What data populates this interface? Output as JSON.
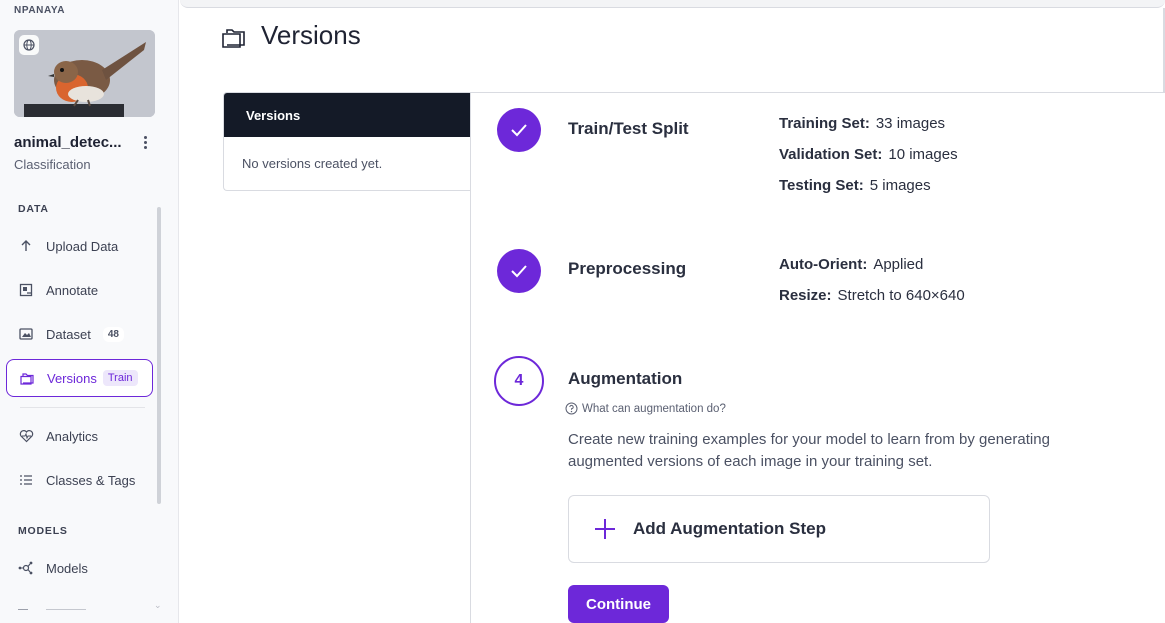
{
  "sidebar": {
    "workspace_name": "NPANAYA",
    "project_name": "animal_detec...",
    "project_type": "Classification",
    "sections": {
      "data": "DATA",
      "models": "MODELS"
    },
    "items": [
      {
        "label": "Upload Data",
        "icon": "upload-arrow-icon"
      },
      {
        "label": "Annotate",
        "icon": "annotate-icon"
      },
      {
        "label": "Dataset",
        "icon": "image-gallery-icon",
        "count": "48"
      },
      {
        "label": "Versions",
        "icon": "folder-icon",
        "badge": "Train"
      },
      {
        "label": "Analytics",
        "icon": "heart-pulse-icon"
      },
      {
        "label": "Classes & Tags",
        "icon": "list-icon"
      },
      {
        "label": "Models",
        "icon": "model-graph-icon"
      }
    ]
  },
  "page": {
    "title": "Versions"
  },
  "versions_panel": {
    "header": "Versions",
    "empty_text": "No versions created yet."
  },
  "steps": {
    "split": {
      "title": "Train/Test Split",
      "rows": [
        {
          "key": "Training Set:",
          "value": "33 images"
        },
        {
          "key": "Validation Set:",
          "value": "10 images"
        },
        {
          "key": "Testing Set:",
          "value": "5 images"
        }
      ]
    },
    "preprocessing": {
      "title": "Preprocessing",
      "rows": [
        {
          "key": "Auto-Orient:",
          "value": "Applied"
        },
        {
          "key": "Resize:",
          "value": "Stretch to 640×640"
        }
      ]
    },
    "augmentation": {
      "number": "4",
      "title": "Augmentation",
      "help": "What can augmentation do?",
      "description": "Create new training examples for your model to learn from by generating augmented versions of each image in your training set.",
      "add_label": "Add Augmentation Step",
      "continue_label": "Continue"
    }
  },
  "colors": {
    "accent": "#6d28d9",
    "header_dark": "#141a27"
  }
}
